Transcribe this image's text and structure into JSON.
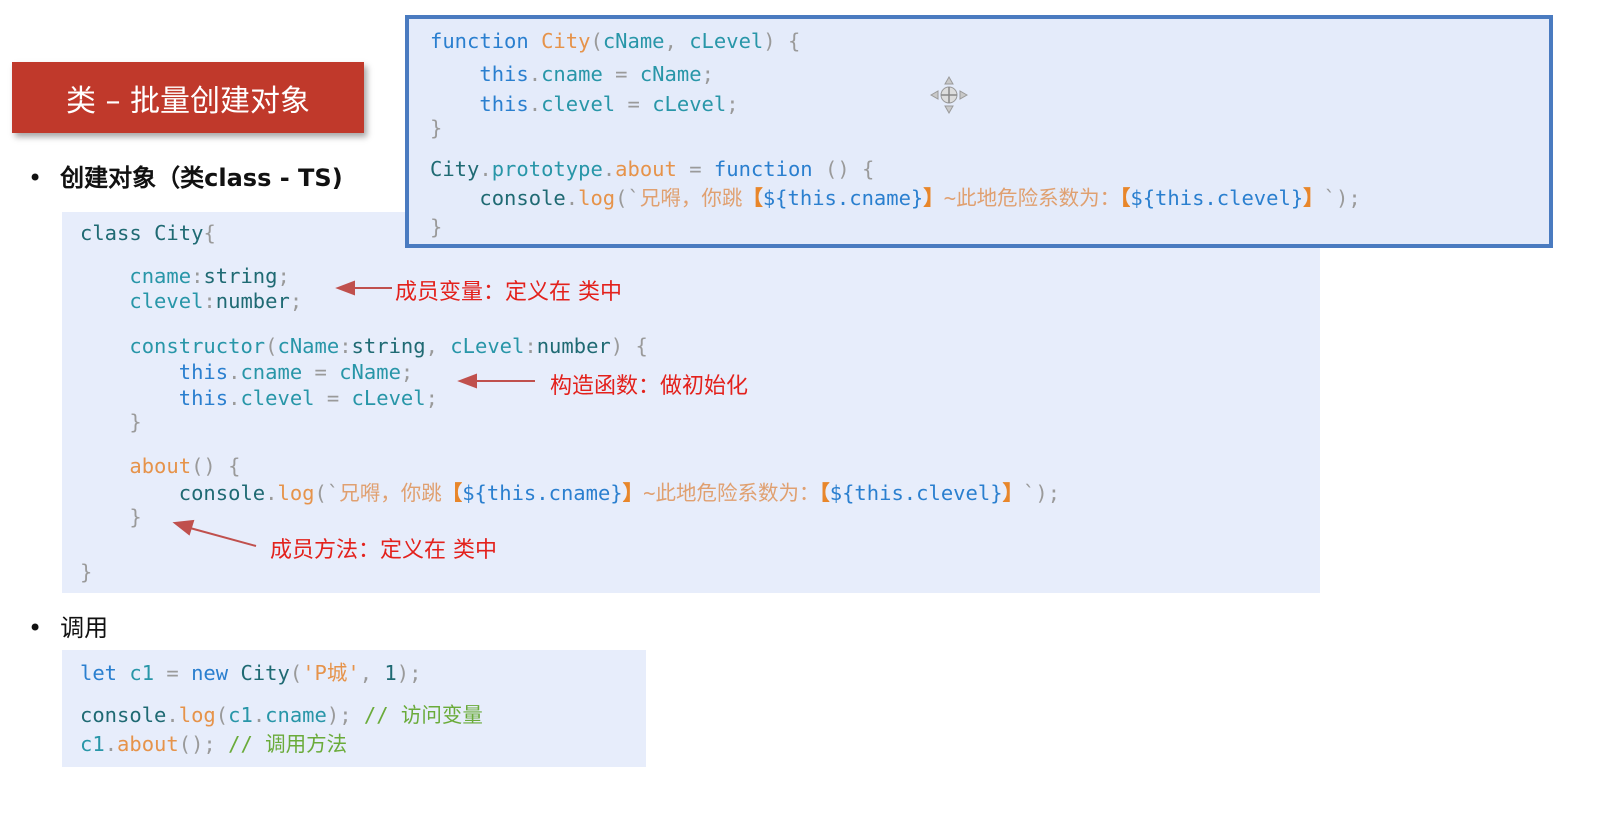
{
  "slide_title": "类 – 批量创建对象",
  "bullets": [
    {
      "label": "创建对象（类class - TS)"
    },
    {
      "label": "调用"
    }
  ],
  "colors": {
    "banner": "#c0392b",
    "annotation": "#e3211c",
    "box_border": "#4a7bc0",
    "code_bg": "#e7edfb"
  },
  "class_code": [
    [
      [
        "class ",
        "t"
      ],
      [
        "City",
        "t"
      ],
      [
        "{",
        "p"
      ]
    ],
    [
      [
        "    cname",
        "v"
      ],
      [
        ":",
        "p"
      ],
      [
        "string",
        "t"
      ],
      [
        ";",
        "p"
      ]
    ],
    [
      [
        "    clevel",
        "v"
      ],
      [
        ":",
        "p"
      ],
      [
        "number",
        "t"
      ],
      [
        ";",
        "p"
      ]
    ],
    [
      [
        "    constructor",
        "v"
      ],
      [
        "(",
        "p"
      ],
      [
        "cName",
        "v"
      ],
      [
        ":",
        "p"
      ],
      [
        "string",
        "t"
      ],
      [
        ", ",
        "p"
      ],
      [
        "cLevel",
        "v"
      ],
      [
        ":",
        "p"
      ],
      [
        "number",
        "t"
      ],
      [
        ") {",
        "p"
      ]
    ],
    [
      [
        "        this",
        "k"
      ],
      [
        ".",
        "p"
      ],
      [
        "cname",
        "v"
      ],
      [
        " = ",
        "p"
      ],
      [
        "cName",
        "v"
      ],
      [
        ";",
        "p"
      ]
    ],
    [
      [
        "        this",
        "k"
      ],
      [
        ".",
        "p"
      ],
      [
        "clevel",
        "v"
      ],
      [
        " = ",
        "p"
      ],
      [
        "cLevel",
        "v"
      ],
      [
        ";",
        "p"
      ]
    ],
    [
      [
        "    }",
        "p"
      ]
    ],
    [
      [
        "    about",
        "f"
      ],
      [
        "() {",
        "p"
      ]
    ],
    [
      [
        "        console",
        "t"
      ],
      [
        ".",
        "p"
      ],
      [
        "log",
        "f"
      ],
      [
        "(`",
        "p"
      ],
      [
        "兄嘚，你跳",
        "s"
      ],
      [
        "【",
        "b"
      ],
      [
        "${this.cname}",
        "k"
      ],
      [
        "】",
        "b"
      ],
      [
        "~此地危险系数为：",
        "s"
      ],
      [
        "【",
        "b"
      ],
      [
        "${this.clevel}",
        "k"
      ],
      [
        "】",
        "b"
      ],
      [
        "`);",
        "p"
      ]
    ],
    [
      [
        "    }",
        "p"
      ]
    ],
    [
      [
        "}",
        "p"
      ]
    ]
  ],
  "func_code": [
    [
      [
        "function ",
        "k"
      ],
      [
        "City",
        "f"
      ],
      [
        "(",
        "p"
      ],
      [
        "cName",
        "v"
      ],
      [
        ", ",
        "p"
      ],
      [
        "cLevel",
        "v"
      ],
      [
        ") {",
        "p"
      ]
    ],
    [
      [
        "    this",
        "k"
      ],
      [
        ".",
        "p"
      ],
      [
        "cname",
        "v"
      ],
      [
        " = ",
        "p"
      ],
      [
        "cName",
        "v"
      ],
      [
        ";",
        "p"
      ]
    ],
    [
      [
        "    this",
        "k"
      ],
      [
        ".",
        "p"
      ],
      [
        "clevel",
        "v"
      ],
      [
        " = ",
        "p"
      ],
      [
        "cLevel",
        "v"
      ],
      [
        ";",
        "p"
      ]
    ],
    [
      [
        "}",
        "p"
      ]
    ],
    [
      [
        "City",
        "t"
      ],
      [
        ".",
        "p"
      ],
      [
        "prototype",
        "v"
      ],
      [
        ".",
        "p"
      ],
      [
        "about",
        "f"
      ],
      [
        " = ",
        "p"
      ],
      [
        "function",
        "k"
      ],
      [
        " () {",
        "p"
      ]
    ],
    [
      [
        "    console",
        "t"
      ],
      [
        ".",
        "p"
      ],
      [
        "log",
        "f"
      ],
      [
        "(`",
        "p"
      ],
      [
        "兄嘚，你跳",
        "s"
      ],
      [
        "【",
        "b"
      ],
      [
        "${this.cname}",
        "k"
      ],
      [
        "】",
        "b"
      ],
      [
        "~此地危险系数为：",
        "s"
      ],
      [
        "【",
        "b"
      ],
      [
        "${this.clevel}",
        "k"
      ],
      [
        "】",
        "b"
      ],
      [
        "`);",
        "p"
      ]
    ],
    [
      [
        "}",
        "p"
      ]
    ]
  ],
  "call_code": [
    [
      [
        "let ",
        "k"
      ],
      [
        "c1",
        "v"
      ],
      [
        " = ",
        "p"
      ],
      [
        "new ",
        "k"
      ],
      [
        "City",
        "t"
      ],
      [
        "(",
        "p"
      ],
      [
        "'P城'",
        "f"
      ],
      [
        ", ",
        "p"
      ],
      [
        "1",
        "t"
      ],
      [
        ");",
        "p"
      ]
    ],
    [
      [
        "console",
        "t"
      ],
      [
        ".",
        "p"
      ],
      [
        "log",
        "f"
      ],
      [
        "(",
        "p"
      ],
      [
        "c1",
        "v"
      ],
      [
        ".",
        "p"
      ],
      [
        "cname",
        "v"
      ],
      [
        "); ",
        "p"
      ],
      [
        "// 访问变量",
        "c"
      ]
    ],
    [
      [
        "c1",
        "v"
      ],
      [
        ".",
        "p"
      ],
      [
        "about",
        "f"
      ],
      [
        "(); ",
        "p"
      ],
      [
        "// 调用方法",
        "c"
      ]
    ]
  ],
  "annotations": {
    "member_vars": "成员变量：定义在 类中",
    "constructor": "构造函数：做初始化",
    "member_method": "成员方法：定义在 类中"
  },
  "icons": {
    "cursor": "move-icon"
  }
}
